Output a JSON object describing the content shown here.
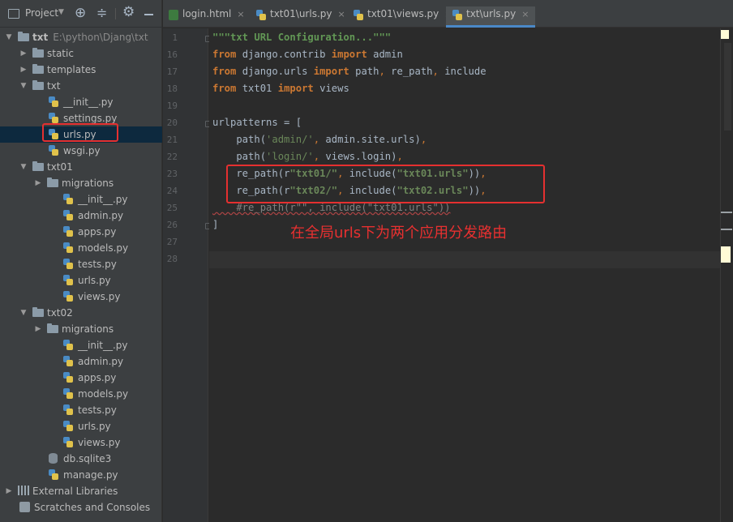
{
  "project_toolbar": {
    "title": "Project",
    "dropdown_icon": "chevron-down-icon",
    "icons": [
      "crosshair-icon",
      "collapse-icon",
      "gear-icon",
      "minimize-icon"
    ]
  },
  "tree": [
    {
      "label": "txt",
      "path": "E:\\python\\Djang\\txt",
      "type": "root-folder",
      "expanded": true
    },
    {
      "label": "static",
      "type": "folder",
      "expanded": false
    },
    {
      "label": "templates",
      "type": "folder",
      "expanded": false
    },
    {
      "label": "txt",
      "type": "folder",
      "expanded": true
    },
    {
      "label": "__init__.py",
      "type": "py"
    },
    {
      "label": "settings.py",
      "type": "py"
    },
    {
      "label": "urls.py",
      "type": "py",
      "selected": true
    },
    {
      "label": "wsgi.py",
      "type": "py"
    },
    {
      "label": "txt01",
      "type": "folder",
      "expanded": true
    },
    {
      "label": "migrations",
      "type": "folder",
      "expanded": false
    },
    {
      "label": "__init__.py",
      "type": "py"
    },
    {
      "label": "admin.py",
      "type": "py"
    },
    {
      "label": "apps.py",
      "type": "py"
    },
    {
      "label": "models.py",
      "type": "py"
    },
    {
      "label": "tests.py",
      "type": "py"
    },
    {
      "label": "urls.py",
      "type": "py"
    },
    {
      "label": "views.py",
      "type": "py"
    },
    {
      "label": "txt02",
      "type": "folder",
      "expanded": true
    },
    {
      "label": "migrations",
      "type": "folder",
      "expanded": false
    },
    {
      "label": "__init__.py",
      "type": "py"
    },
    {
      "label": "admin.py",
      "type": "py"
    },
    {
      "label": "apps.py",
      "type": "py"
    },
    {
      "label": "models.py",
      "type": "py"
    },
    {
      "label": "tests.py",
      "type": "py"
    },
    {
      "label": "urls.py",
      "type": "py"
    },
    {
      "label": "views.py",
      "type": "py"
    },
    {
      "label": "db.sqlite3",
      "type": "db"
    },
    {
      "label": "manage.py",
      "type": "py"
    },
    {
      "label": "External Libraries",
      "type": "lib",
      "expanded": false
    },
    {
      "label": "Scratches and Consoles",
      "type": "scratch"
    }
  ],
  "tabs": [
    {
      "label": "login.html",
      "icon": "html-file-icon",
      "close": "×",
      "active": false
    },
    {
      "label": "txt01\\urls.py",
      "icon": "python-file-icon",
      "close": "×",
      "active": false
    },
    {
      "label": "txt01\\views.py",
      "icon": "python-file-icon",
      "close": "×",
      "active": false
    },
    {
      "label": "txt\\urls.py",
      "icon": "python-file-icon",
      "close": "×",
      "active": true
    }
  ],
  "editor": {
    "line_numbers": [
      "1",
      "16",
      "17",
      "18",
      "19",
      "20",
      "21",
      "22",
      "23",
      "24",
      "25",
      "26",
      "27",
      "28"
    ],
    "lines": [
      {
        "t": "\"\"\"txt URL Configuration...\"\"\"",
        "c": "doc"
      },
      {
        "t": "from django.contrib import admin"
      },
      {
        "t": "from django.urls import path, re_path, include"
      },
      {
        "t": "from txt01 import views"
      },
      {
        "t": ""
      },
      {
        "t": "urlpatterns = ["
      },
      {
        "t": "    path('admin/', admin.site.urls),"
      },
      {
        "t": "    path('login/', views.login),"
      },
      {
        "t": "    re_path(r\"txt01/\", include(\"txt01.urls\")),"
      },
      {
        "t": "    re_path(r\"txt02/\", include(\"txt02.urls\")),"
      },
      {
        "t": "    #re_path(r\"\", include(\"txt01.urls\"))"
      },
      {
        "t": "]"
      },
      {
        "t": ""
      },
      {
        "t": ""
      }
    ],
    "current_line": "28"
  },
  "annotation": "在全局urls下为两个应用分发路由",
  "colors": {
    "highlight_box": "#e53030",
    "keyword": "#cc7832",
    "string": "#6a8759",
    "docstring": "#629755"
  }
}
